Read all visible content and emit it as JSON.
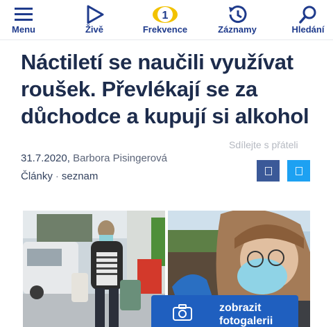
{
  "nav": {
    "items": [
      {
        "label": "Menu",
        "icon": "hamburger-menu-icon"
      },
      {
        "label": "Živě",
        "icon": "play-icon"
      },
      {
        "label": "Frekvence",
        "icon": "frekvence-logo",
        "badge": "1"
      },
      {
        "label": "Záznamy",
        "icon": "history-icon"
      },
      {
        "label": "Hledání",
        "icon": "search-icon"
      }
    ]
  },
  "article": {
    "title_line1": "Náctiletí se naučili využívat",
    "title_line2": "roušek. Převlékají se za",
    "title_line3": "důchodce a kupují si alkohol",
    "date": "31.7.2020,",
    "author": "Barbora Pisingerová",
    "category": "Články",
    "category_sep": "·",
    "tag": "seznam",
    "share_label": "Sdílejte s přáteli"
  },
  "gallery": {
    "line1": "zobrazit",
    "line2": "fotogalerii"
  },
  "colors": {
    "brand_blue": "#1f3b8c",
    "accent_yellow": "#f2c200",
    "facebook": "#3b5998",
    "twitter": "#1da1f2",
    "gallery_button": "#1f5fbf"
  }
}
